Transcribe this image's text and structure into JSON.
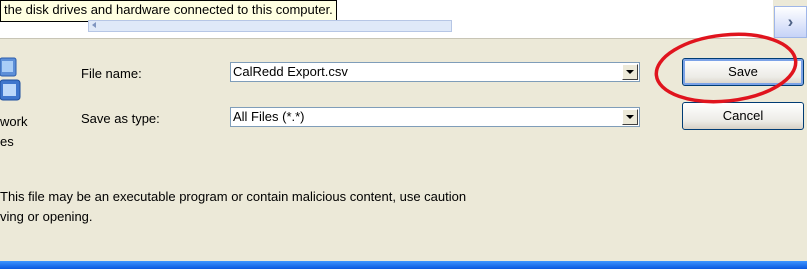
{
  "tooltip": {
    "text": "the disk drives and hardware connected to this computer."
  },
  "scroll": {
    "right_glyph": "›"
  },
  "places": {
    "label_line1": "work",
    "label_line2": "es"
  },
  "file_name": {
    "label": "File name:",
    "value": "CalRedd Export.csv"
  },
  "save_as_type": {
    "label": "Save as type:",
    "value": "All Files (*.*)"
  },
  "buttons": {
    "save": "Save",
    "cancel": "Cancel"
  },
  "warning": {
    "line1": "This file may be an executable program or contain malicious content, use caution",
    "line2": "ving or opening."
  },
  "colors": {
    "highlight": "#e0141e",
    "dialog_bg": "#ece9d8",
    "taskbar": "#0a58df"
  },
  "icons": {
    "scroll_right": "chevron-right-icon",
    "places": "network-places-icon"
  }
}
